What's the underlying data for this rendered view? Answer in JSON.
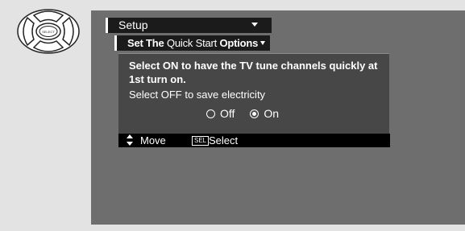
{
  "remote": {
    "center_button_label": "SELECT"
  },
  "menu": {
    "title": "Setup",
    "submenu": {
      "bold_prefix": "Set The",
      "middle": " Quick Start ",
      "bold_suffix": "Options"
    }
  },
  "panel": {
    "description": "Select ON to have the TV tune channels quickly at 1st turn on.",
    "off_hint": "Select OFF to save electricity",
    "options": [
      {
        "label": "Off",
        "selected": false
      },
      {
        "label": "On",
        "selected": true
      }
    ]
  },
  "help_bar": {
    "move_label": "Move",
    "sel_key": "SEL",
    "select_label": "Select"
  }
}
